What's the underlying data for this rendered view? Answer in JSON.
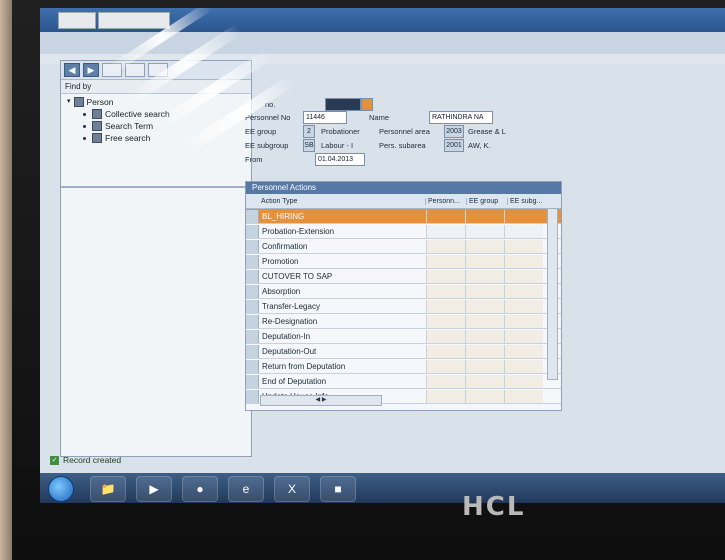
{
  "left_panel": {
    "find_by_label": "Find by",
    "tree": {
      "root_label": "Person",
      "children": [
        {
          "label": "Collective search"
        },
        {
          "label": "Search Term"
        },
        {
          "label": "Free search"
        }
      ]
    }
  },
  "header": {
    "no_label": "no.",
    "personnel_no_label": "Personnel No",
    "personnel_no_value": "11446",
    "name_label": "Name",
    "name_value": "RATHINDRA NA",
    "ee_group_label": "EE group",
    "ee_group_code": "2",
    "ee_group_value": "Probationer",
    "personnel_area_label": "Personnel area",
    "personnel_area_code": "2003",
    "personnel_area_value": "Grease & L",
    "ee_subgroup_label": "EE subgroup",
    "ee_subgroup_code": "SB",
    "ee_subgroup_value": "Labour - I",
    "pers_subarea_label": "Pers. subarea",
    "pers_subarea_code": "2001",
    "pers_subarea_value": "AW, K.",
    "from_label": "From",
    "from_value": "01.04.2013"
  },
  "personnel_actions": {
    "title": "Personnel Actions",
    "columns": [
      "Action Type",
      "Personn...",
      "EE group",
      "EE subg..."
    ],
    "rows": [
      {
        "action": "BL_HIRING",
        "selected": true
      },
      {
        "action": "Probation-Extension"
      },
      {
        "action": "Confirmation"
      },
      {
        "action": "Promotion"
      },
      {
        "action": "CUTOVER TO SAP"
      },
      {
        "action": "Absorption"
      },
      {
        "action": "Transfer-Legacy"
      },
      {
        "action": "Re-Designation"
      },
      {
        "action": "Deputation-In"
      },
      {
        "action": "Deputation-Out"
      },
      {
        "action": "Return from Deputation"
      },
      {
        "action": "End of Deputation"
      },
      {
        "action": "Update House Info"
      }
    ]
  },
  "status_bar": {
    "message": "Record created"
  },
  "taskbar": {
    "icons": [
      "windows-start-icon",
      "file-explorer-icon",
      "media-player-icon",
      "chrome-icon",
      "internet-explorer-icon",
      "excel-icon",
      "sap-icon"
    ]
  },
  "brand": {
    "monitor_logo": "HCL"
  }
}
